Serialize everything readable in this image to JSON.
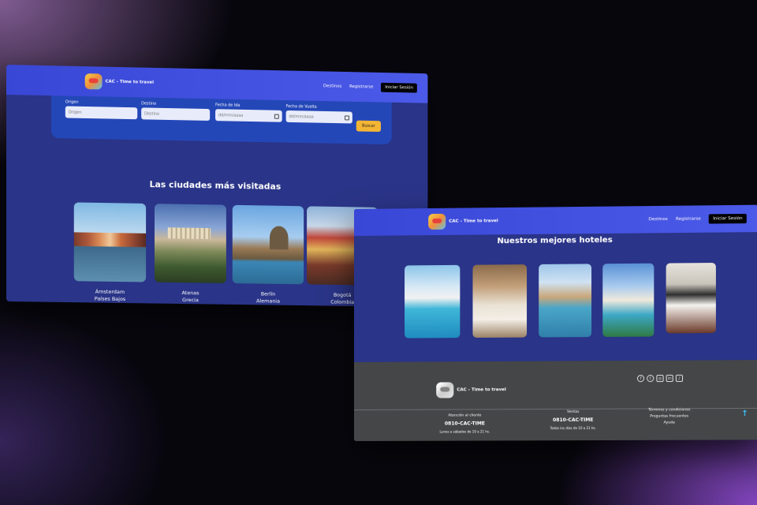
{
  "window1": {
    "brand": "CAC - Time to travel",
    "nav": {
      "destinos": "Destinos",
      "registrarse": "Registrarse",
      "login": "Iniciar Sesión"
    },
    "search": {
      "origen_label": "Origen",
      "origen_placeholder": "Origen",
      "destino_label": "Destino",
      "destino_placeholder": "Destino",
      "ida_label": "Fecha de Ida",
      "ida_value": "dd/mm/aaaa",
      "vuelta_label": "Fecha de Vuelta",
      "vuelta_value": "dd/mm/aaaa",
      "button": "Buscar"
    },
    "cities_title": "Las ciudades más visitadas",
    "cities": [
      {
        "city": "Ámsterdam",
        "country": "Países Bajos"
      },
      {
        "city": "Atenas",
        "country": "Grecia"
      },
      {
        "city": "Berlín",
        "country": "Alemania"
      },
      {
        "city": "Bogotá",
        "country": "Colombia"
      }
    ]
  },
  "window2": {
    "brand": "CAC - Time to travel",
    "nav": {
      "destinos": "Destinos",
      "registrarse": "Registrarse",
      "login": "Iniciar Sesión"
    },
    "hotels_title": "Nuestros mejores hoteles",
    "footer": {
      "brand": "CAC - Time to travel",
      "socials": [
        "facebook-icon",
        "twitter-icon",
        "instagram-icon",
        "linkedin-icon",
        "tiktok-icon"
      ],
      "social_glyphs": [
        "f",
        "t",
        "◎",
        "in",
        "♪"
      ],
      "atencion_label": "Atención al cliente",
      "atencion_phone": "0810-CAC-TIME",
      "atencion_hours": "Lunes a sábados de 10 a 21 hs.",
      "ventas_label": "Ventas",
      "ventas_phone": "0810-CAC-TIME",
      "ventas_hours": "Todos los días de 10 a 21 hs.",
      "links": [
        "Términos y condiciones",
        "Preguntas frecuentes",
        "Ayuda"
      ],
      "to_top": "↑"
    }
  }
}
